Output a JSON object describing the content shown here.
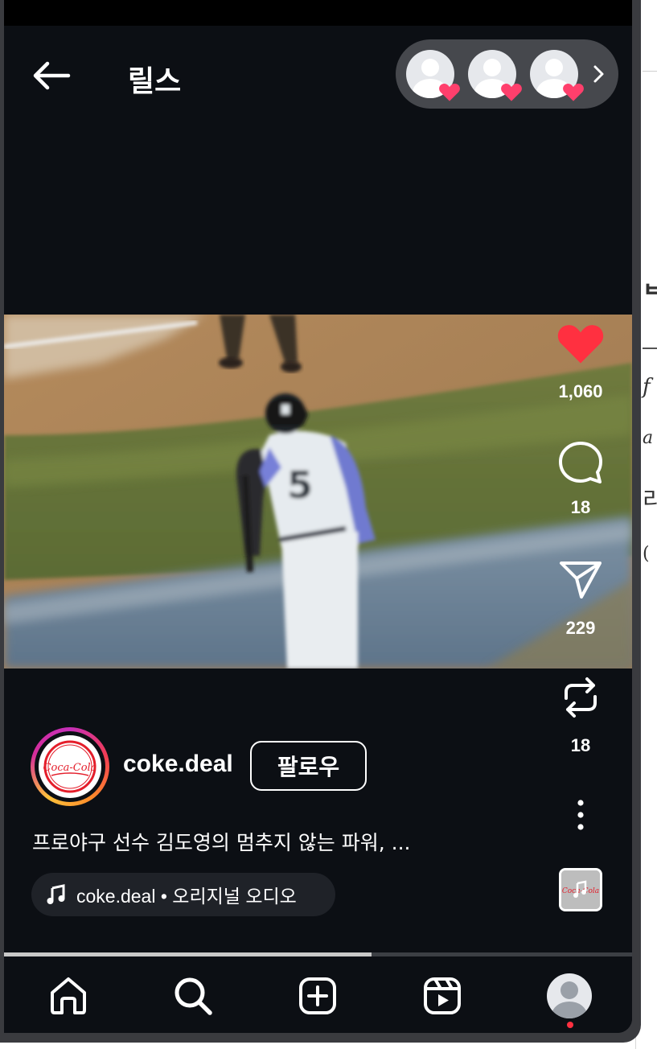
{
  "header": {
    "title": "릴스",
    "likers": [
      "liker-avatar-1",
      "liker-avatar-2",
      "liker-avatar-3"
    ]
  },
  "actions": {
    "like_count": "1,060",
    "comment_count": "18",
    "share_count": "229",
    "remix_count": "18"
  },
  "post": {
    "username": "coke.deal",
    "follow_label": "팔로우",
    "caption": "프로야구 선수 김도영의 멈추지 않는 파워, ...",
    "audio_label": "coke.deal • 오리지널 오디오",
    "avatar_logo_text": "Coca-Cola",
    "jersey_number": "5"
  },
  "playback": {
    "progress": 0.585
  },
  "nav": {
    "items": [
      "home-icon",
      "search-icon",
      "create-icon",
      "reels-icon",
      "profile-avatar"
    ]
  },
  "colors": {
    "background": "#0c0f14",
    "like_red": "#ff3040",
    "pill_bg": "#46484d",
    "coke_red": "#e41e2b"
  }
}
